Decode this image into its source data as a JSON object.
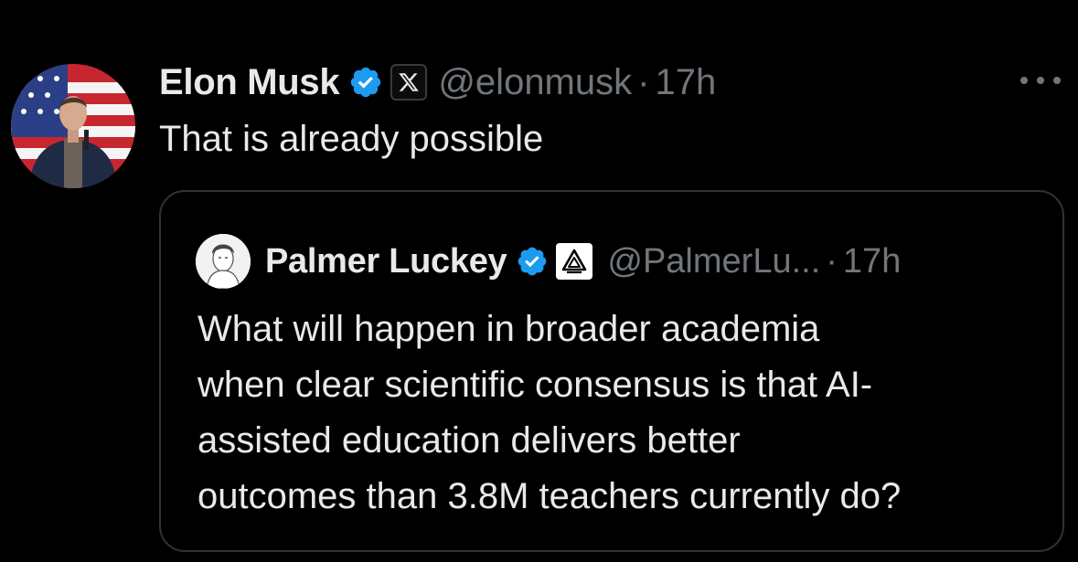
{
  "tweet": {
    "author": {
      "display_name": "Elon Musk",
      "handle": "@elonmusk",
      "verified_icon": "verified-badge-icon",
      "affiliation_icon": "x-logo-icon"
    },
    "separator": "·",
    "time": "17h",
    "more_icon": "more-options-icon",
    "text": "That is already possible"
  },
  "quote": {
    "author": {
      "display_name": "Palmer Luckey",
      "handle": "@PalmerLu...",
      "verified_icon": "verified-badge-icon",
      "affiliation_icon": "anduril-logo-icon"
    },
    "separator": "·",
    "time": "17h",
    "text_lines": [
      "What will happen in broader academia",
      "when clear scientific consensus is that AI-",
      "assisted education delivers better",
      "outcomes than 3.8M teachers currently do?"
    ]
  },
  "colors": {
    "background": "#000000",
    "primary_text": "#e7e9ea",
    "secondary_text": "#71767b",
    "verified_blue": "#1d9bf0",
    "card_border": "#2f3336"
  }
}
